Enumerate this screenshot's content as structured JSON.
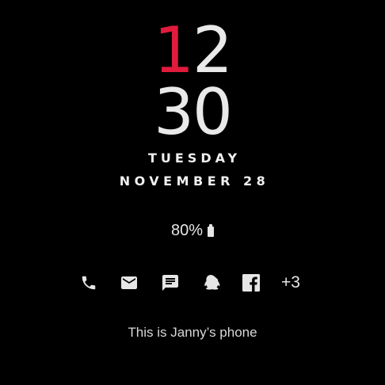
{
  "clock": {
    "hour_first_digit": "1",
    "hour_second_digit": "2",
    "minutes": "30",
    "accent_color": "#e01b3c",
    "digit_color": "#e9e9e9"
  },
  "date": {
    "weekday": "TUESDAY",
    "month_day": "NOVEMBER 28"
  },
  "battery": {
    "percent_label": "80%",
    "icon": "battery-icon"
  },
  "notifications": {
    "icons": [
      "phone-icon",
      "mail-icon",
      "message-icon",
      "qq-icon",
      "facebook-icon"
    ],
    "more_label": "+3"
  },
  "owner_info": "This is Janny’s phone"
}
